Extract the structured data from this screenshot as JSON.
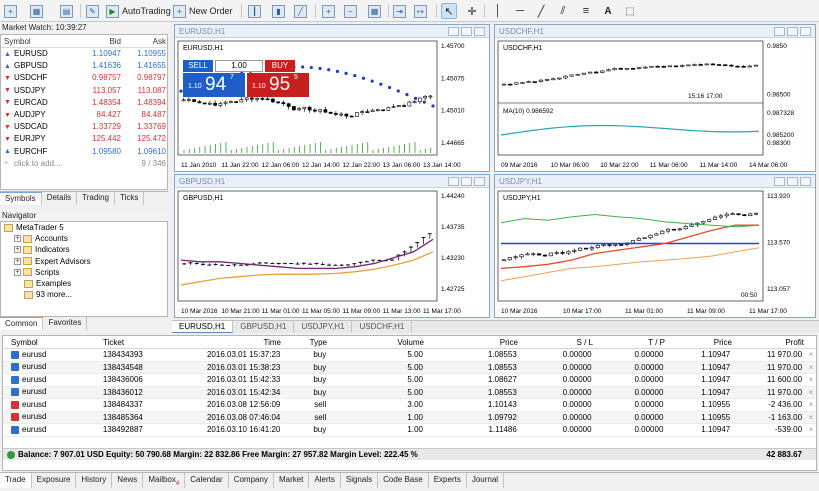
{
  "toolbar": {
    "autotrading_label": "AutoTrading",
    "neworder_label": "New Order"
  },
  "market_watch": {
    "title": "Market Watch: 10:39:27",
    "columns": [
      "Symbol",
      "Bid",
      "Ask"
    ],
    "rows": [
      {
        "symbol": "EURUSD",
        "bid": "1.10947",
        "ask": "1.10955",
        "trend": "up"
      },
      {
        "symbol": "GBPUSD",
        "bid": "1.41636",
        "ask": "1.41655",
        "trend": "up"
      },
      {
        "symbol": "USDCHF",
        "bid": "0.98757",
        "ask": "0.98797",
        "trend": "down"
      },
      {
        "symbol": "USDJPY",
        "bid": "113.057",
        "ask": "113.087",
        "trend": "down"
      },
      {
        "symbol": "EURCAD",
        "bid": "1.48354",
        "ask": "1.48394",
        "trend": "down"
      },
      {
        "symbol": "AUDJPY",
        "bid": "84.427",
        "ask": "84.487",
        "trend": "down"
      },
      {
        "symbol": "USDCAD",
        "bid": "1.33729",
        "ask": "1.33769",
        "trend": "down"
      },
      {
        "symbol": "EURJPY",
        "bid": "125.442",
        "ask": "125.472",
        "trend": "down"
      },
      {
        "symbol": "EURCHF",
        "bid": "1.09580",
        "ask": "1.09610",
        "trend": "up"
      }
    ],
    "add_label": "click to add...",
    "count": "9 / 346",
    "tabs": [
      "Symbols",
      "Details",
      "Trading",
      "Ticks"
    ]
  },
  "navigator": {
    "title": "Navigator",
    "items": [
      {
        "label": "MetaTrader 5",
        "indent": 0
      },
      {
        "label": "Accounts",
        "indent": 1
      },
      {
        "label": "Indicators",
        "indent": 1
      },
      {
        "label": "Expert Advisors",
        "indent": 1
      },
      {
        "label": "Scripts",
        "indent": 1
      },
      {
        "label": "Examples",
        "indent": 2
      },
      {
        "label": "93 more...",
        "indent": 2
      }
    ],
    "tabs": [
      "Common",
      "Favorites"
    ]
  },
  "charts": [
    {
      "window_title": "EURUSD,H1",
      "label": "EURUSD,H1",
      "prices": [
        "1.45700",
        "1.45075",
        "1.45010",
        "1.44665"
      ],
      "times": [
        "11 Jan 2010",
        "11 Jan 22:00",
        "12 Jan 06:00",
        "12 Jan 14:00",
        "12 Jan 22:00",
        "13 Jan 06:00",
        "13 Jan 14:00"
      ]
    },
    {
      "window_title": "USDCHF,H1",
      "label": "USDCHF,H1",
      "prices": [
        "0.9850",
        "0.98500",
        "0.98300"
      ],
      "indicator": "MA(10) 0.986592",
      "indicator_prices": [
        "0.987328",
        "0.985200"
      ],
      "times": [
        "09 Mar 2016",
        "10 Mar 06:00",
        "10 Mar 22:00",
        "11 Mar 06:00",
        "11 Mar 14:00",
        "14 Mar 06:00"
      ],
      "time_marker": "15:16 17:00"
    },
    {
      "window_title": "GBPUSD,H1",
      "label": "GBPUSD,H1",
      "prices": [
        "1.44240",
        "1.43735",
        "1.43230",
        "1.42725"
      ],
      "times": [
        "10 Mar 2016",
        "10 Mar 21:00",
        "11 Mar 01:00",
        "11 Mar 05:00",
        "11 Mar 09:00",
        "11 Mar 13:00",
        "11 Mar 17:00"
      ]
    },
    {
      "window_title": "USDJPY,H1",
      "label": "USDJPY,H1",
      "prices": [
        "113.920",
        "113.570",
        "113.057"
      ],
      "times": [
        "10 Mar 2016",
        "10 Mar 17:00",
        "11 Mar 01:00",
        "11 Mar 09:00",
        "11 Mar 17:00"
      ],
      "time_marker": "00:50"
    }
  ],
  "trade_panel": {
    "sell_label": "SELL",
    "buy_label": "BUY",
    "volume": "1.00",
    "sell_price_small": "1.10",
    "sell_price_big": "94",
    "sell_price_sup": "7",
    "buy_price_small": "1.10",
    "buy_price_big": "95",
    "buy_price_sup": "5"
  },
  "chart_tabs": [
    "EURUSD,H1",
    "GBPUSD,H1",
    "USDJPY,H1",
    "USDCHF,H1"
  ],
  "terminal": {
    "columns": [
      "Symbol",
      "Ticket",
      "Time",
      "Type",
      "Volume",
      "Price",
      "S / L",
      "T / P",
      "Price",
      "Profit"
    ],
    "rows": [
      {
        "symbol": "eurusd",
        "ticket": "138434393",
        "time": "2016.03.01 15:37:23",
        "type": "buy",
        "volume": "5.00",
        "price": "1.08553",
        "sl": "0.00000",
        "tp": "0.00000",
        "cur": "1.10947",
        "profit": "11 970.00"
      },
      {
        "symbol": "eurusd",
        "ticket": "138434548",
        "time": "2016.03.01 15:38:23",
        "type": "buy",
        "volume": "5.00",
        "price": "1.08553",
        "sl": "0.00000",
        "tp": "0.00000",
        "cur": "1.10947",
        "profit": "11 970.00"
      },
      {
        "symbol": "eurusd",
        "ticket": "138436006",
        "time": "2016.03.01 15:42:33",
        "type": "buy",
        "volume": "5.00",
        "price": "1.08627",
        "sl": "0.00000",
        "tp": "0.00000",
        "cur": "1.10947",
        "profit": "11 600.00"
      },
      {
        "symbol": "eurusd",
        "ticket": "138436012",
        "time": "2016.03.01 15:42:34",
        "type": "buy",
        "volume": "5.00",
        "price": "1.08553",
        "sl": "0.00000",
        "tp": "0.00000",
        "cur": "1.10947",
        "profit": "11 970.00"
      },
      {
        "symbol": "eurusd",
        "ticket": "138484337",
        "time": "2016.03.08 12:56:09",
        "type": "sell",
        "volume": "3.00",
        "price": "1.10143",
        "sl": "0.00000",
        "tp": "0.00000",
        "cur": "1.10955",
        "profit": "-2 436.00"
      },
      {
        "symbol": "eurusd",
        "ticket": "138485364",
        "time": "2016.03.08 07:46:04",
        "type": "sell",
        "volume": "1.00",
        "price": "1.09792",
        "sl": "0.00000",
        "tp": "0.00000",
        "cur": "1.10955",
        "profit": "-1 163.00"
      },
      {
        "symbol": "eurusd",
        "ticket": "138492887",
        "time": "2016.03.10 16:41:20",
        "type": "buy",
        "volume": "1.00",
        "price": "1.11486",
        "sl": "0.00000",
        "tp": "0.00000",
        "cur": "1.10947",
        "profit": "-539.00"
      }
    ],
    "balance_line": "Balance: 7 907.01 USD  Equity: 50 790.68  Margin: 22 832.86  Free Margin: 27 957.82  Margin Level: 222.45 %",
    "total_profit": "42 883.67",
    "tabs": [
      "Trade",
      "Exposure",
      "History",
      "News",
      "Mailbox",
      "Calendar",
      "Company",
      "Market",
      "Alerts",
      "Signals",
      "Code Base",
      "Experts",
      "Journal"
    ],
    "mailbox_badge": "4"
  },
  "colors": {
    "up": "#2f6ecf",
    "down": "#d43333",
    "bull": "#ffffff",
    "bear": "#000000",
    "sell": "#1f5ec8",
    "buy": "#c8201f"
  }
}
